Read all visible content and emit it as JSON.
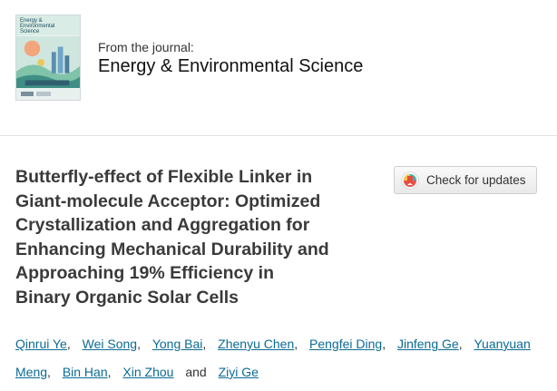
{
  "journal": {
    "cover_title": "Energy & Environmental Science",
    "from_label": "From the journal:",
    "name": "Energy & Environmental Science"
  },
  "article": {
    "title_lines": [
      "Butterfly-effect of Flexible Linker in",
      "Giant-molecule Acceptor: Optimized",
      "Crystallization and Aggregation for",
      "Enhancing Mechanical Durability and",
      "Approaching 19% Efficiency in",
      "Binary Organic Solar Cells"
    ],
    "check_updates_label": "Check for updates"
  },
  "authors": {
    "names": [
      "Qinrui Ye",
      "Wei Song",
      "Yong Bai",
      "Zhenyu Chen",
      "Pengfei Ding",
      "Jinfeng Ge",
      "Yuanyuan Meng",
      "Bin Han",
      "Xin Zhou",
      "Ziyi Ge"
    ],
    "comma": ",",
    "and": "and"
  },
  "colors": {
    "link": "#0b6b94",
    "title": "#3a3a3a",
    "divider": "#e3e3e3"
  }
}
